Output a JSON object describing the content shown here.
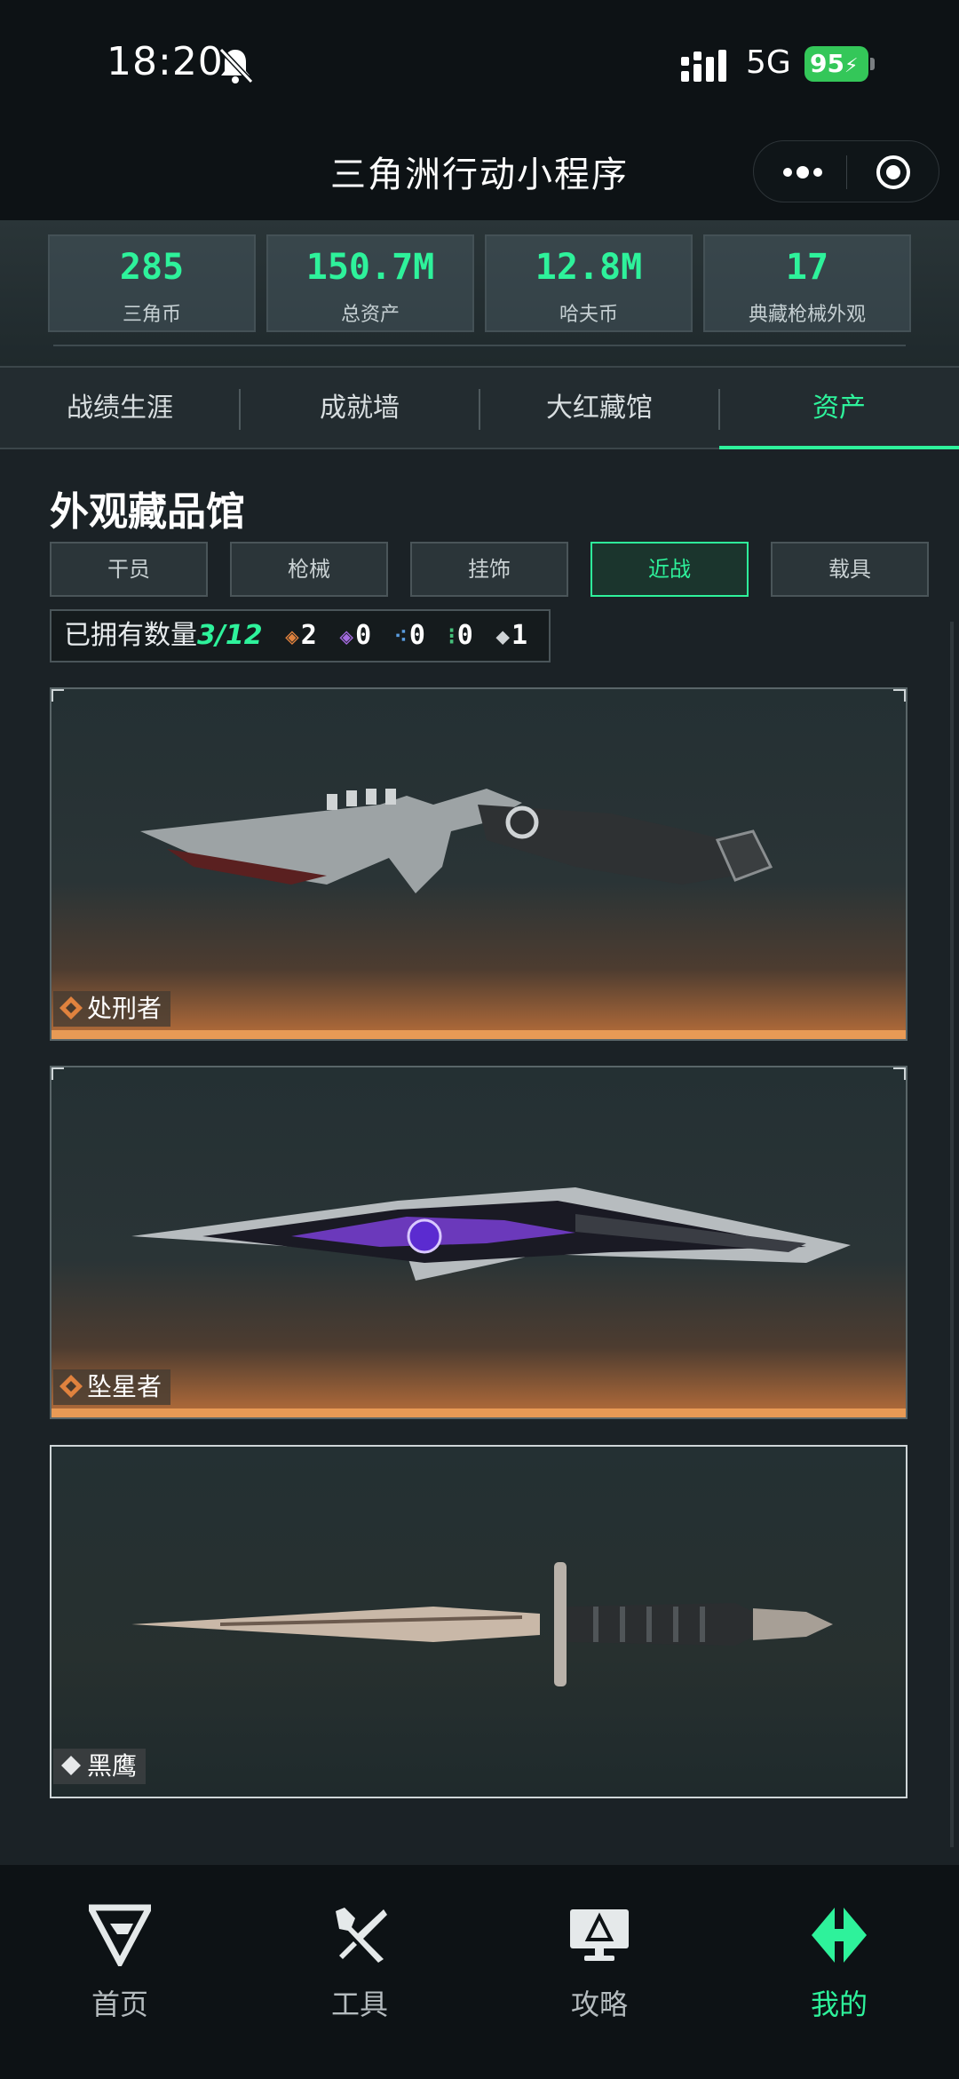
{
  "status": {
    "time": "18:20",
    "network": "5G",
    "battery": "95"
  },
  "header": {
    "title": "三角洲行动小程序"
  },
  "stats": [
    {
      "value": "285",
      "label": "三角币"
    },
    {
      "value": "150.7M",
      "label": "总资产"
    },
    {
      "value": "12.8M",
      "label": "哈夫币"
    },
    {
      "value": "17",
      "label": "典藏枪械外观"
    }
  ],
  "tabs": [
    {
      "label": "战绩生涯"
    },
    {
      "label": "成就墙"
    },
    {
      "label": "大红藏馆"
    },
    {
      "label": "资产"
    }
  ],
  "section": {
    "title": "外观藏品馆"
  },
  "filters": [
    {
      "label": "干员"
    },
    {
      "label": "枪械"
    },
    {
      "label": "挂饰"
    },
    {
      "label": "近战"
    },
    {
      "label": "载具"
    }
  ],
  "owned": {
    "label": "已拥有数量",
    "count": "3/12",
    "rarities": [
      {
        "value": "2",
        "color": "#e0823e"
      },
      {
        "value": "0",
        "color": "#a46be0"
      },
      {
        "value": "0",
        "color": "#5a9de0"
      },
      {
        "value": "0",
        "color": "#45c07a"
      },
      {
        "value": "1",
        "color": "#cfd4d6"
      }
    ]
  },
  "items": [
    {
      "name": "处刑者",
      "rarity_color": "#e0823e"
    },
    {
      "name": "坠星者",
      "rarity_color": "#e0823e"
    },
    {
      "name": "黑鹰",
      "rarity_color": "#e6e8ea"
    }
  ],
  "nav": [
    {
      "label": "首页",
      "icon": "home-logo-icon"
    },
    {
      "label": "工具",
      "icon": "tools-icon"
    },
    {
      "label": "攻略",
      "icon": "guide-monitor-icon"
    },
    {
      "label": "我的",
      "icon": "profile-logo-icon"
    }
  ],
  "colors": {
    "accent": "#2ef29b",
    "background": "#1b2226"
  }
}
